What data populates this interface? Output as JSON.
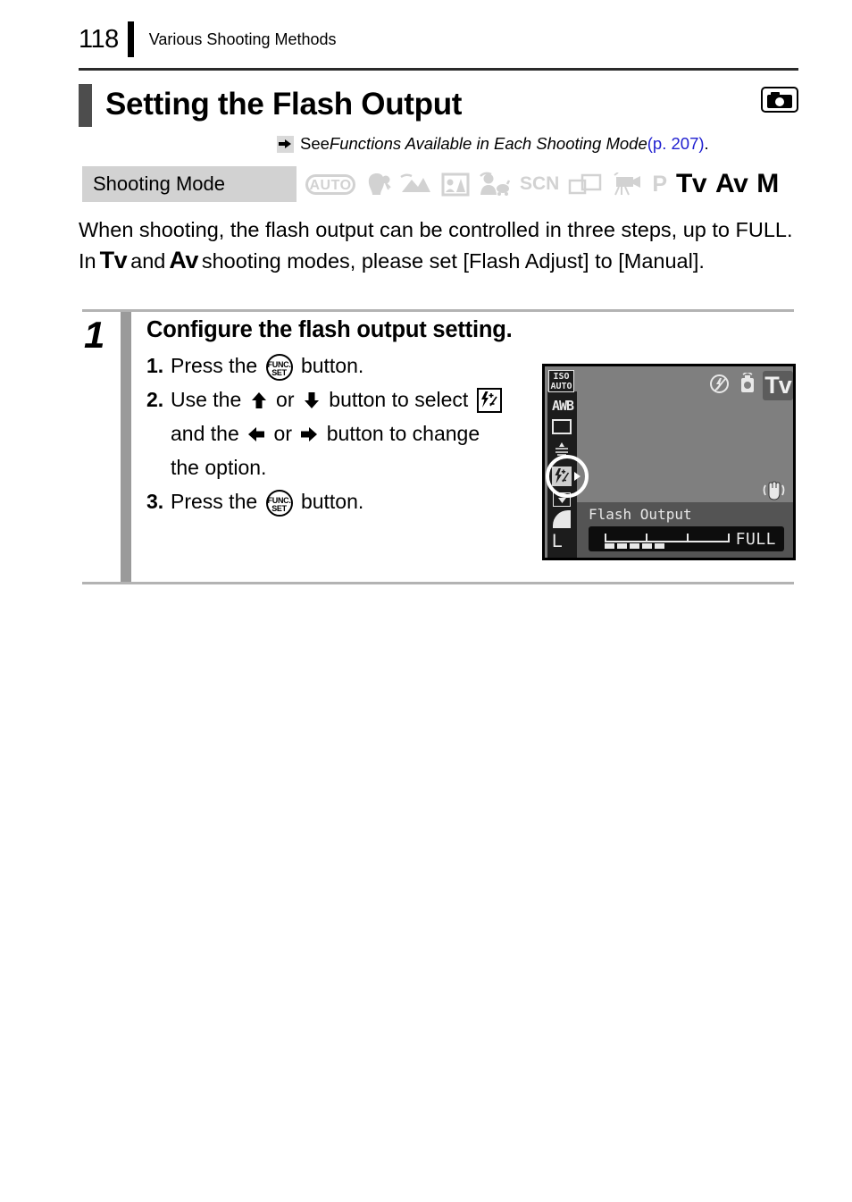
{
  "header": {
    "page_number": "118",
    "chapter": "Various Shooting Methods"
  },
  "section": {
    "title": "Setting the Flash Output",
    "camera_icon": "camera-icon"
  },
  "reference": {
    "arrow_icon": "right-arrow-icon",
    "see_label": "See ",
    "reference_title": "Functions Available in Each Shooting Mode",
    "page_ref": " (p. 207)",
    "period": ".",
    "link_color": "#2020d0"
  },
  "shooting_mode": {
    "label": "Shooting Mode",
    "modes": [
      {
        "name": "auto",
        "label": "AUTO",
        "active": false
      },
      {
        "name": "portrait",
        "label": "",
        "active": false
      },
      {
        "name": "landscape",
        "label": "",
        "active": false
      },
      {
        "name": "night-snapshot",
        "label": "",
        "active": false
      },
      {
        "name": "kids-and-pets",
        "label": "",
        "active": false
      },
      {
        "name": "scn",
        "label": "SCN",
        "active": false
      },
      {
        "name": "stitch-assist",
        "label": "",
        "active": false
      },
      {
        "name": "movie",
        "label": "",
        "active": false
      },
      {
        "name": "program",
        "label": "P",
        "active": false
      },
      {
        "name": "shutter-priority",
        "label": "Tv",
        "active": true
      },
      {
        "name": "aperture-priority",
        "label": "Av",
        "active": true
      },
      {
        "name": "manual",
        "label": "M",
        "active": true
      }
    ]
  },
  "body": {
    "line1": "When shooting, the flash output can be controlled in three steps, up to",
    "line2a": "FULL. In",
    "mode_tv": "Tv",
    "line2b": "and",
    "mode_av": "Av",
    "line2c": "shooting modes, please set [Flash Adjust] to",
    "line3": "[Manual]."
  },
  "step": {
    "number": "1",
    "title": "Configure the flash output setting.",
    "substeps": [
      {
        "num": "1.",
        "text_before": "Press the",
        "icon": "func-set-button-icon",
        "text_after": "button."
      },
      {
        "num": "2.",
        "text_before": "Use the",
        "arrow_up": "up-arrow-icon",
        "or1": "or",
        "arrow_down": "down-arrow-icon",
        "mid": "button to select",
        "icon": "flash-output-icon",
        "line2_before": "and the",
        "arrow_left": "left-arrow-icon",
        "or2": "or",
        "arrow_right": "right-arrow-icon",
        "line2_after": "button to change",
        "line3": "the option."
      },
      {
        "num": "3.",
        "text_before": "Press the",
        "icon": "func-set-button-icon",
        "text_after": "button."
      }
    ],
    "func_set_line1": "FUNC.",
    "func_set_line2": "SET"
  },
  "lcd": {
    "iso_line1": "ISO",
    "iso_line2": "AUTO",
    "white_balance": "AWB",
    "metering_icon": "evaluative-metering-icon",
    "drive_mode_icon": "drive-mode-icon",
    "selected_icon": "flash-output-icon",
    "selection_caret": "right-caret-icon",
    "redeye_icon": "red-eye-reduction-icon",
    "quality_icon": "image-quality-fine-icon",
    "image_size": "L",
    "flash_off_icon": "flash-off-icon",
    "camera_icon": "camera-icon",
    "mode_badge": "Tv",
    "camera_shake_icon": "camera-shake-warning-icon",
    "panel_label": "Flash Output",
    "value": "FULL",
    "scale_levels": 5,
    "scale_filled": 5,
    "background_color": "#7f7f7f",
    "panel_color": "#545454"
  }
}
